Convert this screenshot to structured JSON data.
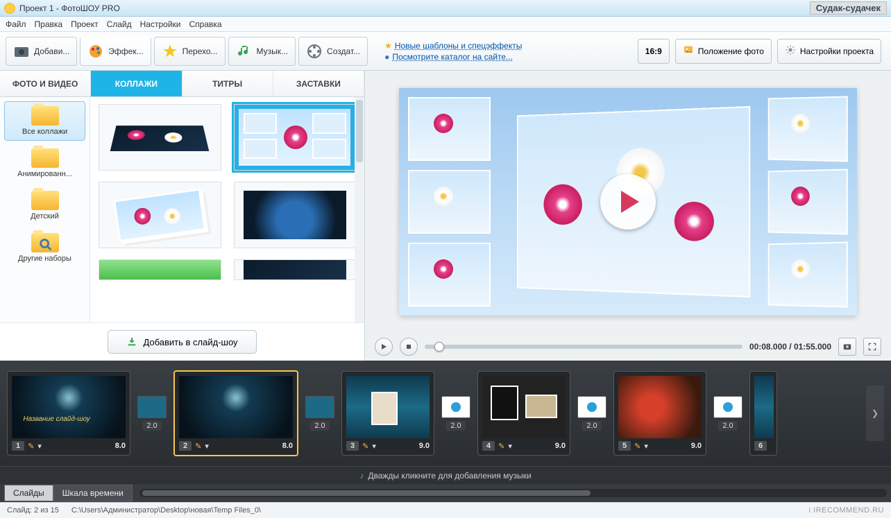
{
  "titlebar": {
    "title": "Проект 1 - ФотоШОУ PRO",
    "watermark": "Судак-судачек"
  },
  "menu": {
    "file": "Файл",
    "edit": "Правка",
    "project": "Проект",
    "slide": "Слайд",
    "settings": "Настройки",
    "help": "Справка"
  },
  "toolbar": {
    "add": "Добави...",
    "effects": "Эффек...",
    "transitions": "Перехо...",
    "music": "Музык...",
    "create": "Создат...",
    "link1": "Новые шаблоны и спецэффекты",
    "link2": "Посмотрите каталог на сайте...",
    "aspect": "16:9",
    "position": "Положение фото",
    "proj_settings": "Настройки проекта"
  },
  "categories": {
    "photo": "ФОТО И ВИДЕО",
    "collages": "КОЛЛАЖИ",
    "titles": "ТИТРЫ",
    "splash": "ЗАСТАВКИ"
  },
  "side": {
    "all": "Все коллажи",
    "anim": "Анимированн...",
    "kids": "Детский",
    "other": "Другие наборы"
  },
  "addbtn": "Добавить в слайд-шоу",
  "player": {
    "time": "00:08.000 / 01:55.000"
  },
  "timeline": {
    "slides": [
      {
        "n": "1",
        "dur": "8.0"
      },
      {
        "n": "2",
        "dur": "8.0"
      },
      {
        "n": "3",
        "dur": "9.0"
      },
      {
        "n": "4",
        "dur": "9.0"
      },
      {
        "n": "5",
        "dur": "9.0"
      },
      {
        "n": "6",
        "dur": ""
      }
    ],
    "trans": "2.0",
    "music_hint": "Дважды кликните для добавления музыки"
  },
  "bottom_tabs": {
    "slides": "Слайды",
    "tl": "Шкала времени"
  },
  "status": {
    "slide": "Слайд: 2 из 15",
    "path": "C:\\Users\\Администратор\\Desktop\\новая\\Temp Files_0\\",
    "wm": "i IRECOMMEND.RU"
  }
}
